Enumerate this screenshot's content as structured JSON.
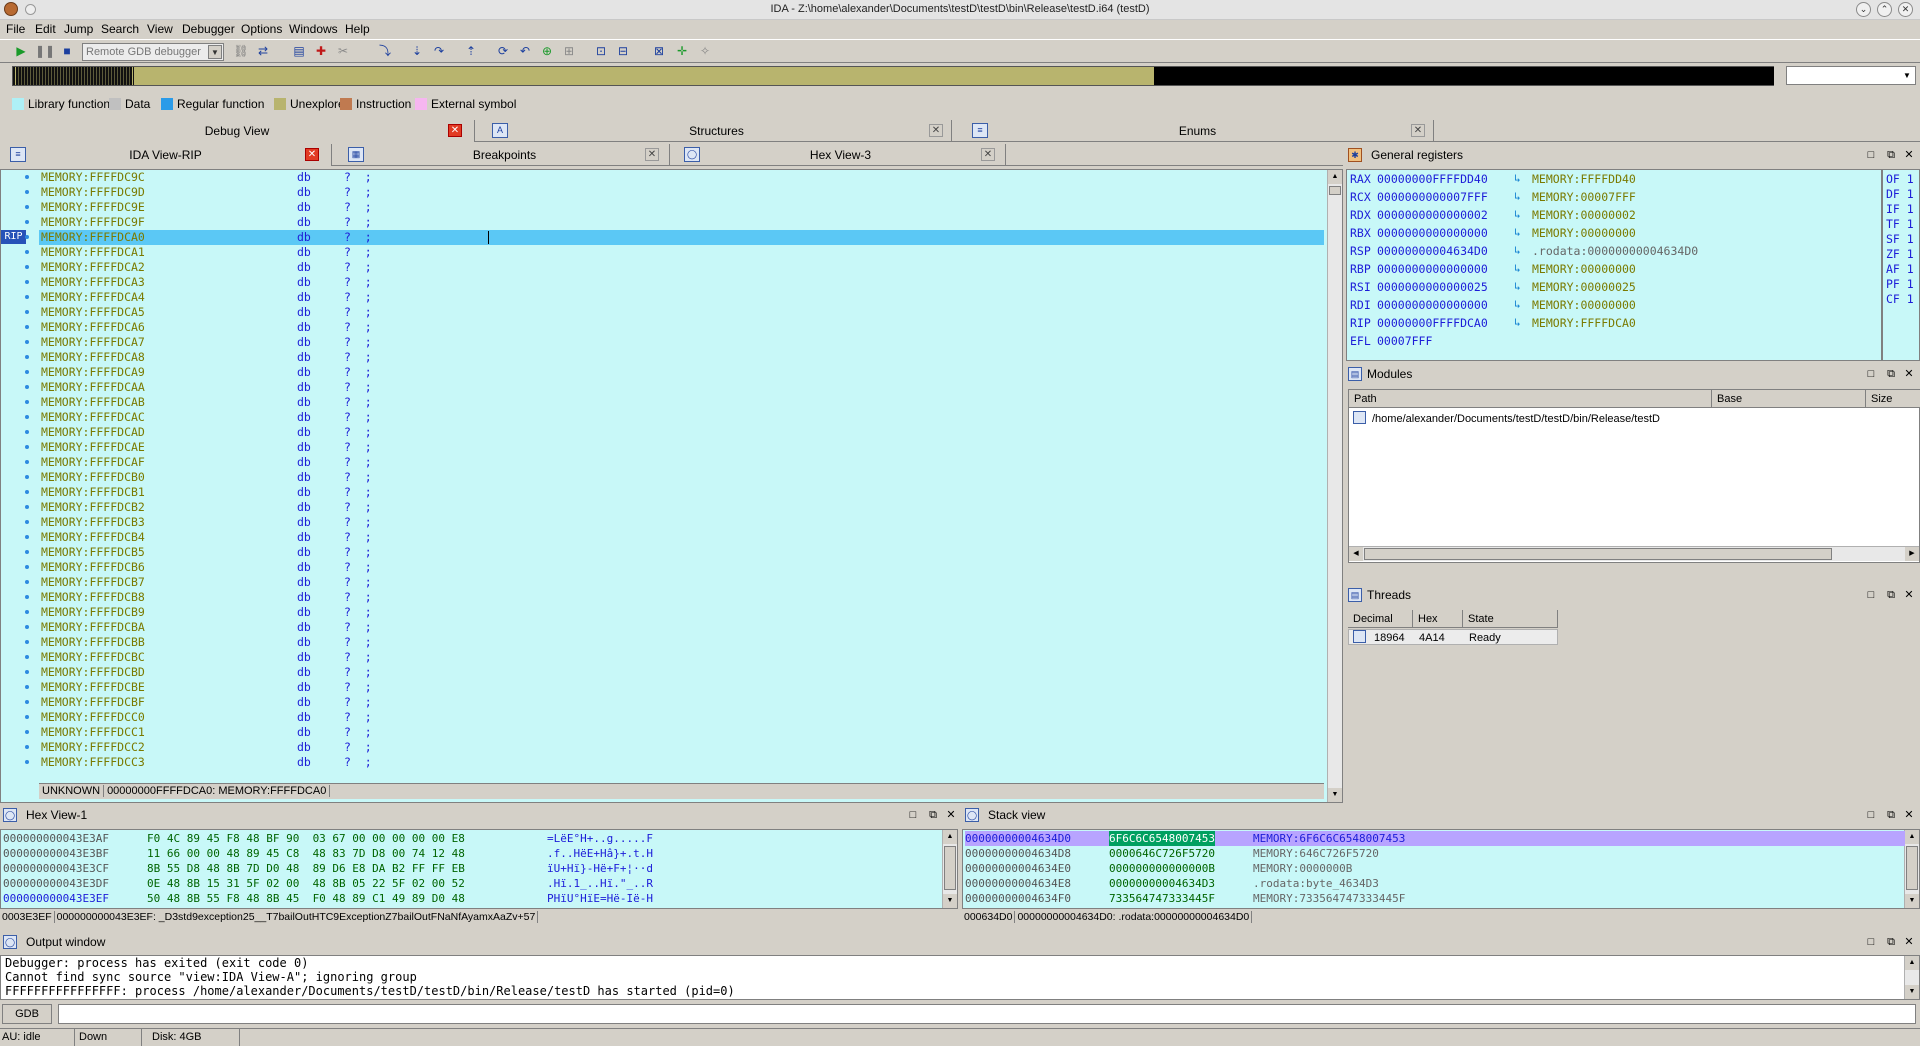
{
  "window": {
    "title": "IDA - Z:\\home\\alexander\\Documents\\testD\\testD\\bin\\Release\\testD.i64 (testD)"
  },
  "menu": [
    "File",
    "Edit",
    "Jump",
    "Search",
    "View",
    "Debugger",
    "Options",
    "Windows",
    "Help"
  ],
  "toolbar": {
    "debugger_select": "Remote GDB debugger"
  },
  "legend": [
    {
      "label": "Library function",
      "color": "#aef0f6"
    },
    {
      "label": "Data",
      "color": "#c0c0c0"
    },
    {
      "label": "Regular function",
      "color": "#2a9be8"
    },
    {
      "label": "Unexplored",
      "color": "#b8b46e"
    },
    {
      "label": "Instruction",
      "color": "#c07a50"
    },
    {
      "label": "External symbol",
      "color": "#f6b6f0"
    }
  ],
  "top_tabs": [
    "Debug View",
    "Structures",
    "Enums"
  ],
  "sub_tabs": [
    "IDA View-RIP",
    "Breakpoints",
    "Hex View-3"
  ],
  "code": {
    "rip_label": "RIP",
    "selected_index": 4,
    "lines": [
      {
        "addr": "MEMORY:FFFFDC9C",
        "op": "db",
        "arg": "?  ;"
      },
      {
        "addr": "MEMORY:FFFFDC9D",
        "op": "db",
        "arg": "?  ;"
      },
      {
        "addr": "MEMORY:FFFFDC9E",
        "op": "db",
        "arg": "?  ;"
      },
      {
        "addr": "MEMORY:FFFFDC9F",
        "op": "db",
        "arg": "?  ;"
      },
      {
        "addr": "MEMORY:FFFFDCA0",
        "op": "db",
        "arg": "?  ;"
      },
      {
        "addr": "MEMORY:FFFFDCA1",
        "op": "db",
        "arg": "?  ;"
      },
      {
        "addr": "MEMORY:FFFFDCA2",
        "op": "db",
        "arg": "?  ;"
      },
      {
        "addr": "MEMORY:FFFFDCA3",
        "op": "db",
        "arg": "?  ;"
      },
      {
        "addr": "MEMORY:FFFFDCA4",
        "op": "db",
        "arg": "?  ;"
      },
      {
        "addr": "MEMORY:FFFFDCA5",
        "op": "db",
        "arg": "?  ;"
      },
      {
        "addr": "MEMORY:FFFFDCA6",
        "op": "db",
        "arg": "?  ;"
      },
      {
        "addr": "MEMORY:FFFFDCA7",
        "op": "db",
        "arg": "?  ;"
      },
      {
        "addr": "MEMORY:FFFFDCA8",
        "op": "db",
        "arg": "?  ;"
      },
      {
        "addr": "MEMORY:FFFFDCA9",
        "op": "db",
        "arg": "?  ;"
      },
      {
        "addr": "MEMORY:FFFFDCAA",
        "op": "db",
        "arg": "?  ;"
      },
      {
        "addr": "MEMORY:FFFFDCAB",
        "op": "db",
        "arg": "?  ;"
      },
      {
        "addr": "MEMORY:FFFFDCAC",
        "op": "db",
        "arg": "?  ;"
      },
      {
        "addr": "MEMORY:FFFFDCAD",
        "op": "db",
        "arg": "?  ;"
      },
      {
        "addr": "MEMORY:FFFFDCAE",
        "op": "db",
        "arg": "?  ;"
      },
      {
        "addr": "MEMORY:FFFFDCAF",
        "op": "db",
        "arg": "?  ;"
      },
      {
        "addr": "MEMORY:FFFFDCB0",
        "op": "db",
        "arg": "?  ;"
      },
      {
        "addr": "MEMORY:FFFFDCB1",
        "op": "db",
        "arg": "?  ;"
      },
      {
        "addr": "MEMORY:FFFFDCB2",
        "op": "db",
        "arg": "?  ;"
      },
      {
        "addr": "MEMORY:FFFFDCB3",
        "op": "db",
        "arg": "?  ;"
      },
      {
        "addr": "MEMORY:FFFFDCB4",
        "op": "db",
        "arg": "?  ;"
      },
      {
        "addr": "MEMORY:FFFFDCB5",
        "op": "db",
        "arg": "?  ;"
      },
      {
        "addr": "MEMORY:FFFFDCB6",
        "op": "db",
        "arg": "?  ;"
      },
      {
        "addr": "MEMORY:FFFFDCB7",
        "op": "db",
        "arg": "?  ;"
      },
      {
        "addr": "MEMORY:FFFFDCB8",
        "op": "db",
        "arg": "?  ;"
      },
      {
        "addr": "MEMORY:FFFFDCB9",
        "op": "db",
        "arg": "?  ;"
      },
      {
        "addr": "MEMORY:FFFFDCBA",
        "op": "db",
        "arg": "?  ;"
      },
      {
        "addr": "MEMORY:FFFFDCBB",
        "op": "db",
        "arg": "?  ;"
      },
      {
        "addr": "MEMORY:FFFFDCBC",
        "op": "db",
        "arg": "?  ;"
      },
      {
        "addr": "MEMORY:FFFFDCBD",
        "op": "db",
        "arg": "?  ;"
      },
      {
        "addr": "MEMORY:FFFFDCBE",
        "op": "db",
        "arg": "?  ;"
      },
      {
        "addr": "MEMORY:FFFFDCBF",
        "op": "db",
        "arg": "?  ;"
      },
      {
        "addr": "MEMORY:FFFFDCC0",
        "op": "db",
        "arg": "?  ;"
      },
      {
        "addr": "MEMORY:FFFFDCC1",
        "op": "db",
        "arg": "?  ;"
      },
      {
        "addr": "MEMORY:FFFFDCC2",
        "op": "db",
        "arg": "?  ;"
      },
      {
        "addr": "MEMORY:FFFFDCC3",
        "op": "db",
        "arg": "?  ;"
      }
    ],
    "status_left": "UNKNOWN",
    "status_right": "00000000FFFFDCA0: MEMORY:FFFFDCA0"
  },
  "registers": {
    "title": "General registers",
    "rows": [
      {
        "name": "RAX",
        "value": "00000000FFFFDD40",
        "target": "MEMORY:FFFFDD40"
      },
      {
        "name": "RCX",
        "value": "0000000000007FFF",
        "target": "MEMORY:00007FFF"
      },
      {
        "name": "RDX",
        "value": "0000000000000002",
        "target": "MEMORY:00000002"
      },
      {
        "name": "RBX",
        "value": "0000000000000000",
        "target": "MEMORY:00000000"
      },
      {
        "name": "RSP",
        "value": "00000000004634D0",
        "target": ".rodata:00000000004634D0"
      },
      {
        "name": "RBP",
        "value": "0000000000000000",
        "target": "MEMORY:00000000"
      },
      {
        "name": "RSI",
        "value": "0000000000000025",
        "target": "MEMORY:00000025"
      },
      {
        "name": "RDI",
        "value": "0000000000000000",
        "target": "MEMORY:00000000"
      },
      {
        "name": "RIP",
        "value": "00000000FFFFDCA0",
        "target": "MEMORY:FFFFDCA0"
      },
      {
        "name": "EFL",
        "value": "00007FFF",
        "target": ""
      }
    ],
    "flags": [
      "OF 1",
      "DF 1",
      "IF 1",
      "TF 1",
      "SF 1",
      "ZF 1",
      "AF 1",
      "PF 1",
      "CF 1"
    ]
  },
  "modules": {
    "title": "Modules",
    "columns": [
      "Path",
      "Base",
      "Size"
    ],
    "rows": [
      {
        "path": "/home/alexander/Documents/testD/testD/bin/Release/testD"
      }
    ]
  },
  "threads": {
    "title": "Threads",
    "columns": [
      "Decimal",
      "Hex",
      "State"
    ],
    "rows": [
      {
        "decimal": "18964",
        "hex": "4A14",
        "state": "Ready"
      }
    ]
  },
  "hexview": {
    "title": "Hex View-1",
    "rows": [
      {
        "addr": "000000000043E3AF",
        "bytes": "F0 4C 89 45 F8 48 BF 90  03 67 00 00 00 00 00 E8",
        "ascii": "=LëE°H+..g.....F"
      },
      {
        "addr": "000000000043E3BF",
        "bytes": "11 66 00 00 48 89 45 C8  48 83 7D D8 00 74 12 48",
        "ascii": ".f..HëE+Hâ}+.t.H"
      },
      {
        "addr": "000000000043E3CF",
        "bytes": "8B 55 D8 48 8B 7D D0 48  89 D6 E8 DA B2 FF FF EB",
        "ascii": "ïU+Hï}-Hë+F+¦··d"
      },
      {
        "addr": "000000000043E3DF",
        "bytes": "0E 48 8B 15 31 5F 02 00  48 8B 05 22 5F 02 00 52",
        "ascii": ".Hï.1_..Hï.\"_..R"
      },
      {
        "addr": "000000000043E3EF",
        "bytes": "50 48 8B 55 F8 48 8B 45  F0 48 89 C1 49 89 D0 48",
        "ascii": "PHïU°HïE=Hë-Ië-H"
      }
    ],
    "status_left": "0003E3EF",
    "status_right": "000000000043E3EF: _D3std9exception25__T7bailOutHTC9ExceptionZ7bailOutFNaNfAyamxAaZv+57"
  },
  "stack": {
    "title": "Stack view",
    "rows": [
      {
        "addr": "00000000004634D0",
        "value": "6F6C6C6548007453",
        "comment": "MEMORY:6F6C6C6548007453"
      },
      {
        "addr": "00000000004634D8",
        "value": "0000646C726F5720",
        "comment": "MEMORY:646C726F5720"
      },
      {
        "addr": "00000000004634E0",
        "value": "000000000000000B",
        "comment": "MEMORY:0000000B"
      },
      {
        "addr": "00000000004634E8",
        "value": "00000000004634D3",
        "comment": ".rodata:byte_4634D3"
      },
      {
        "addr": "00000000004634F0",
        "value": "733564747333445F",
        "comment": "MEMORY:733564747333445F"
      }
    ],
    "status_left": "000634D0",
    "status_right": "00000000004634D0: .rodata:00000000004634D0"
  },
  "output": {
    "title": "Output window",
    "lines": [
      "Debugger: process has exited (exit code 0)",
      "Cannot find sync source \"view:IDA View-A\"; ignoring group",
      "FFFFFFFFFFFFFFFF: process /home/alexander/Documents/testD/testD/bin/Release/testD has started (pid=0)"
    ],
    "gdb_label": "GDB"
  },
  "statusbar": {
    "au": "AU:  idle",
    "dir": "Down",
    "disk": "Disk: 4GB"
  }
}
